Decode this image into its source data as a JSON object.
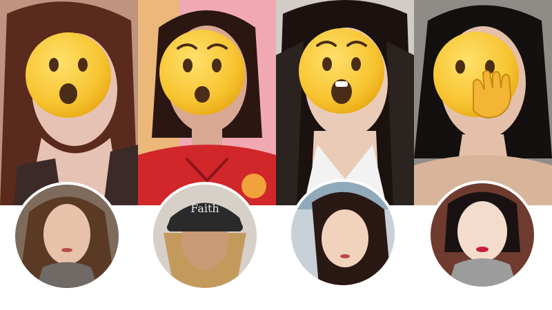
{
  "collage": {
    "panels": [
      {
        "name": "panel-1",
        "emoji": "hushed-face-icon",
        "bg": "#c9a08f",
        "hair": "#5a2a1c",
        "skin": "#e6c2b4",
        "cloth": "#3b2a28"
      },
      {
        "name": "panel-2",
        "emoji": "hushed-face-icon",
        "bg": "#f0a9b3",
        "hair": "#2b1612",
        "skin": "#d8a892",
        "cloth": "#d1262a"
      },
      {
        "name": "panel-3",
        "emoji": "face-with-open-mouth-icon",
        "bg": "#2b2320",
        "hair": "#1b1210",
        "skin": "#e9cbb7",
        "cloth": "#f2f2f2"
      },
      {
        "name": "panel-4",
        "emoji": "face-with-hand-over-mouth-icon",
        "bg": "#8f8c88",
        "hair": "#141010",
        "skin": "#e4c0aa",
        "cloth": "#d8b49a"
      }
    ],
    "avatars": [
      {
        "name": "avatar-1",
        "bg": "#7e6b5c",
        "hair": "#5a3a24",
        "skin": "#e7c1aa",
        "accent": "#6f6a66"
      },
      {
        "name": "avatar-2",
        "bg": "#d7d0c8",
        "hair": "#c39a5c",
        "skin": "#c99a74",
        "accent": "#2a2a2a"
      },
      {
        "name": "avatar-3",
        "bg": "#c9d1d8",
        "hair": "#2a1814",
        "skin": "#f0d2bd",
        "accent": "#6a8fa8"
      },
      {
        "name": "avatar-4",
        "bg": "#6e3b2e",
        "hair": "#1a1212",
        "skin": "#f4dccd",
        "accent": "#9c9c9c"
      }
    ]
  },
  "colors": {
    "emoji_face": "#f7c431",
    "emoji_shade": "#e8a913",
    "emoji_feature": "#4a2d16",
    "background": "#ffffff"
  }
}
